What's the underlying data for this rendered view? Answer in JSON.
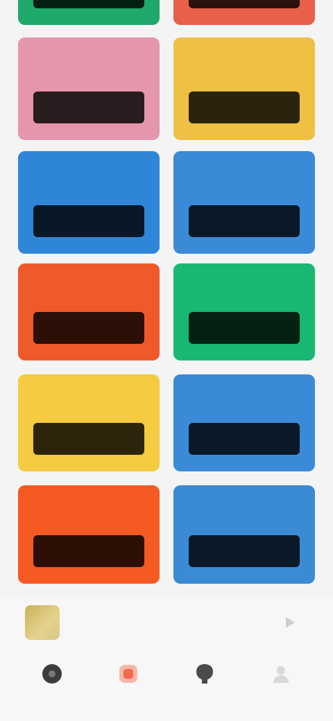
{
  "cards": [
    {
      "title": "",
      "color": "#1faa6b"
    },
    {
      "title": "",
      "color": "#e8604a"
    },
    {
      "title": "",
      "color": "#e596ad"
    },
    {
      "title": "",
      "color": "#eec043"
    },
    {
      "title": "",
      "color": "#2f86d8"
    },
    {
      "title": "",
      "color": "#3a8ad8"
    },
    {
      "title": "",
      "color": "#f05a2b"
    },
    {
      "title": "",
      "color": "#19b872"
    },
    {
      "title": "",
      "color": "#f4cb41"
    },
    {
      "title": "",
      "color": "#3a8ad8"
    },
    {
      "title": "",
      "color": "#f55a23"
    },
    {
      "title": "",
      "color": "#3b8ad6"
    }
  ],
  "now_playing": {
    "title": "",
    "subtitle": "",
    "play_icon": "play-icon"
  },
  "tabs": [
    {
      "id": "home",
      "label": "",
      "icon": "home-icon",
      "active": false
    },
    {
      "id": "discover",
      "label": "",
      "icon": "discover-icon",
      "active": true
    },
    {
      "id": "library",
      "label": "",
      "icon": "library-icon",
      "active": false
    },
    {
      "id": "profile",
      "label": "",
      "icon": "profile-icon",
      "active": false
    }
  ],
  "colors": {
    "accent": "#f36a4f",
    "background": "#f4f4f4",
    "bar": "#f7f7f7"
  }
}
